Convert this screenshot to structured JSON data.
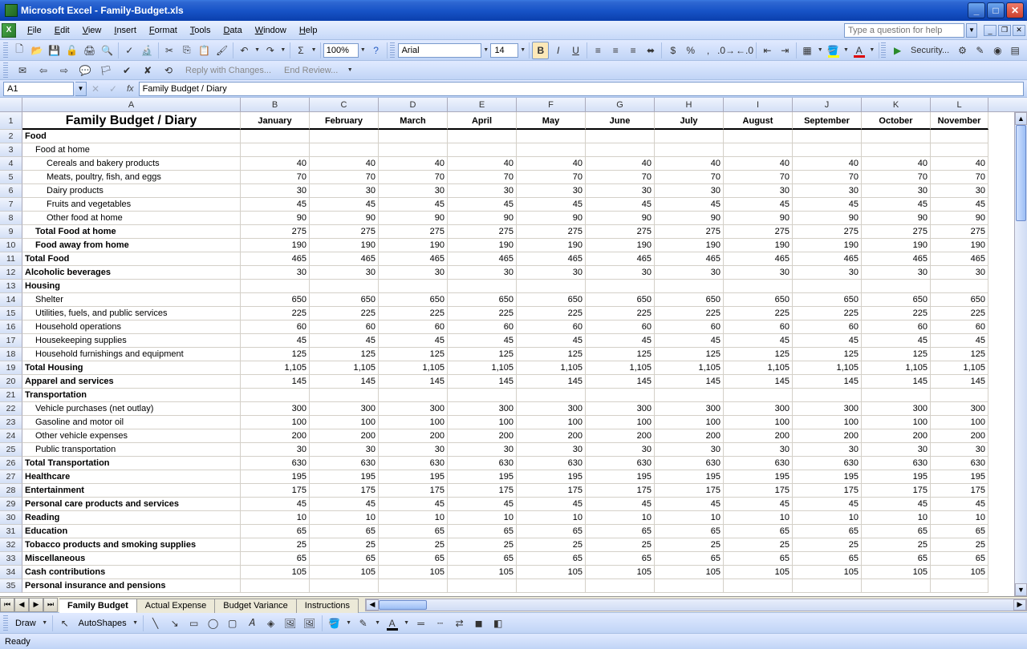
{
  "window": {
    "title": "Microsoft Excel - Family-Budget.xls"
  },
  "menus": [
    "File",
    "Edit",
    "View",
    "Insert",
    "Format",
    "Tools",
    "Data",
    "Window",
    "Help"
  ],
  "help_placeholder": "Type a question for help",
  "toolbar": {
    "zoom": "100%",
    "font_name": "Arial",
    "font_size": "14",
    "security_label": "Security...",
    "reply_label": "Reply with Changes...",
    "end_review_label": "End Review..."
  },
  "namebox": "A1",
  "formula": "Family Budget / Diary",
  "columns": [
    "A",
    "B",
    "C",
    "D",
    "E",
    "F",
    "G",
    "H",
    "I",
    "J",
    "K",
    "L"
  ],
  "col_widths": {
    "A": 272,
    "B": 86,
    "C": 86,
    "D": 86,
    "E": 86,
    "F": 86,
    "G": 86,
    "H": 86,
    "I": 86,
    "J": 86,
    "K": 86,
    "L": 72
  },
  "months": [
    "January",
    "February",
    "March",
    "April",
    "May",
    "June",
    "July",
    "August",
    "September",
    "October",
    "November"
  ],
  "sheet": {
    "title": "Family Budget / Diary",
    "rows": [
      {
        "n": 2,
        "label": "Food",
        "bold": true,
        "indent": 0,
        "vals": null
      },
      {
        "n": 3,
        "label": "Food at home",
        "bold": false,
        "indent": 1,
        "vals": null
      },
      {
        "n": 4,
        "label": "Cereals and bakery products",
        "bold": false,
        "indent": 2,
        "vals": [
          "40",
          "40",
          "40",
          "40",
          "40",
          "40",
          "40",
          "40",
          "40",
          "40",
          "40"
        ]
      },
      {
        "n": 5,
        "label": "Meats, poultry, fish, and eggs",
        "bold": false,
        "indent": 2,
        "vals": [
          "70",
          "70",
          "70",
          "70",
          "70",
          "70",
          "70",
          "70",
          "70",
          "70",
          "70"
        ]
      },
      {
        "n": 6,
        "label": "Dairy products",
        "bold": false,
        "indent": 2,
        "vals": [
          "30",
          "30",
          "30",
          "30",
          "30",
          "30",
          "30",
          "30",
          "30",
          "30",
          "30"
        ]
      },
      {
        "n": 7,
        "label": "Fruits and vegetables",
        "bold": false,
        "indent": 2,
        "vals": [
          "45",
          "45",
          "45",
          "45",
          "45",
          "45",
          "45",
          "45",
          "45",
          "45",
          "45"
        ]
      },
      {
        "n": 8,
        "label": "Other food at home",
        "bold": false,
        "indent": 2,
        "vals": [
          "90",
          "90",
          "90",
          "90",
          "90",
          "90",
          "90",
          "90",
          "90",
          "90",
          "90"
        ]
      },
      {
        "n": 9,
        "label": "Total Food at home",
        "bold": true,
        "indent": 1,
        "vals": [
          "275",
          "275",
          "275",
          "275",
          "275",
          "275",
          "275",
          "275",
          "275",
          "275",
          "275"
        ]
      },
      {
        "n": 10,
        "label": "Food away from home",
        "bold": true,
        "indent": 1,
        "vals": [
          "190",
          "190",
          "190",
          "190",
          "190",
          "190",
          "190",
          "190",
          "190",
          "190",
          "190"
        ]
      },
      {
        "n": 11,
        "label": "Total Food",
        "bold": true,
        "indent": 0,
        "vals": [
          "465",
          "465",
          "465",
          "465",
          "465",
          "465",
          "465",
          "465",
          "465",
          "465",
          "465"
        ]
      },
      {
        "n": 12,
        "label": "Alcoholic beverages",
        "bold": true,
        "indent": 0,
        "vals": [
          "30",
          "30",
          "30",
          "30",
          "30",
          "30",
          "30",
          "30",
          "30",
          "30",
          "30"
        ]
      },
      {
        "n": 13,
        "label": "Housing",
        "bold": true,
        "indent": 0,
        "vals": null
      },
      {
        "n": 14,
        "label": "Shelter",
        "bold": false,
        "indent": 1,
        "vals": [
          "650",
          "650",
          "650",
          "650",
          "650",
          "650",
          "650",
          "650",
          "650",
          "650",
          "650"
        ]
      },
      {
        "n": 15,
        "label": "Utilities, fuels, and public services",
        "bold": false,
        "indent": 1,
        "vals": [
          "225",
          "225",
          "225",
          "225",
          "225",
          "225",
          "225",
          "225",
          "225",
          "225",
          "225"
        ]
      },
      {
        "n": 16,
        "label": "Household operations",
        "bold": false,
        "indent": 1,
        "vals": [
          "60",
          "60",
          "60",
          "60",
          "60",
          "60",
          "60",
          "60",
          "60",
          "60",
          "60"
        ]
      },
      {
        "n": 17,
        "label": "Housekeeping supplies",
        "bold": false,
        "indent": 1,
        "vals": [
          "45",
          "45",
          "45",
          "45",
          "45",
          "45",
          "45",
          "45",
          "45",
          "45",
          "45"
        ]
      },
      {
        "n": 18,
        "label": "Household furnishings and equipment",
        "bold": false,
        "indent": 1,
        "vals": [
          "125",
          "125",
          "125",
          "125",
          "125",
          "125",
          "125",
          "125",
          "125",
          "125",
          "125"
        ]
      },
      {
        "n": 19,
        "label": "Total Housing",
        "bold": true,
        "indent": 0,
        "vals": [
          "1,105",
          "1,105",
          "1,105",
          "1,105",
          "1,105",
          "1,105",
          "1,105",
          "1,105",
          "1,105",
          "1,105",
          "1,105"
        ]
      },
      {
        "n": 20,
        "label": "Apparel and services",
        "bold": true,
        "indent": 0,
        "vals": [
          "145",
          "145",
          "145",
          "145",
          "145",
          "145",
          "145",
          "145",
          "145",
          "145",
          "145"
        ]
      },
      {
        "n": 21,
        "label": "Transportation",
        "bold": true,
        "indent": 0,
        "vals": null
      },
      {
        "n": 22,
        "label": "Vehicle purchases (net outlay)",
        "bold": false,
        "indent": 1,
        "vals": [
          "300",
          "300",
          "300",
          "300",
          "300",
          "300",
          "300",
          "300",
          "300",
          "300",
          "300"
        ]
      },
      {
        "n": 23,
        "label": "Gasoline and motor oil",
        "bold": false,
        "indent": 1,
        "vals": [
          "100",
          "100",
          "100",
          "100",
          "100",
          "100",
          "100",
          "100",
          "100",
          "100",
          "100"
        ]
      },
      {
        "n": 24,
        "label": "Other vehicle expenses",
        "bold": false,
        "indent": 1,
        "vals": [
          "200",
          "200",
          "200",
          "200",
          "200",
          "200",
          "200",
          "200",
          "200",
          "200",
          "200"
        ]
      },
      {
        "n": 25,
        "label": "Public transportation",
        "bold": false,
        "indent": 1,
        "vals": [
          "30",
          "30",
          "30",
          "30",
          "30",
          "30",
          "30",
          "30",
          "30",
          "30",
          "30"
        ]
      },
      {
        "n": 26,
        "label": "Total Transportation",
        "bold": true,
        "indent": 0,
        "vals": [
          "630",
          "630",
          "630",
          "630",
          "630",
          "630",
          "630",
          "630",
          "630",
          "630",
          "630"
        ]
      },
      {
        "n": 27,
        "label": "Healthcare",
        "bold": true,
        "indent": 0,
        "vals": [
          "195",
          "195",
          "195",
          "195",
          "195",
          "195",
          "195",
          "195",
          "195",
          "195",
          "195"
        ]
      },
      {
        "n": 28,
        "label": "Entertainment",
        "bold": true,
        "indent": 0,
        "vals": [
          "175",
          "175",
          "175",
          "175",
          "175",
          "175",
          "175",
          "175",
          "175",
          "175",
          "175"
        ]
      },
      {
        "n": 29,
        "label": "Personal care products and services",
        "bold": true,
        "indent": 0,
        "vals": [
          "45",
          "45",
          "45",
          "45",
          "45",
          "45",
          "45",
          "45",
          "45",
          "45",
          "45"
        ]
      },
      {
        "n": 30,
        "label": "Reading",
        "bold": true,
        "indent": 0,
        "vals": [
          "10",
          "10",
          "10",
          "10",
          "10",
          "10",
          "10",
          "10",
          "10",
          "10",
          "10"
        ]
      },
      {
        "n": 31,
        "label": "Education",
        "bold": true,
        "indent": 0,
        "vals": [
          "65",
          "65",
          "65",
          "65",
          "65",
          "65",
          "65",
          "65",
          "65",
          "65",
          "65"
        ]
      },
      {
        "n": 32,
        "label": "Tobacco products and smoking supplies",
        "bold": true,
        "indent": 0,
        "vals": [
          "25",
          "25",
          "25",
          "25",
          "25",
          "25",
          "25",
          "25",
          "25",
          "25",
          "25"
        ]
      },
      {
        "n": 33,
        "label": "Miscellaneous",
        "bold": true,
        "indent": 0,
        "vals": [
          "65",
          "65",
          "65",
          "65",
          "65",
          "65",
          "65",
          "65",
          "65",
          "65",
          "65"
        ]
      },
      {
        "n": 34,
        "label": "Cash contributions",
        "bold": true,
        "indent": 0,
        "vals": [
          "105",
          "105",
          "105",
          "105",
          "105",
          "105",
          "105",
          "105",
          "105",
          "105",
          "105"
        ]
      },
      {
        "n": 35,
        "label": "Personal insurance and pensions",
        "bold": true,
        "indent": 0,
        "vals": null
      }
    ]
  },
  "sheet_tabs": [
    "Family Budget",
    "Actual Expense",
    "Budget Variance",
    "Instructions"
  ],
  "active_tab": 0,
  "drawbar": {
    "draw": "Draw",
    "autoshapes": "AutoShapes"
  },
  "status": "Ready"
}
